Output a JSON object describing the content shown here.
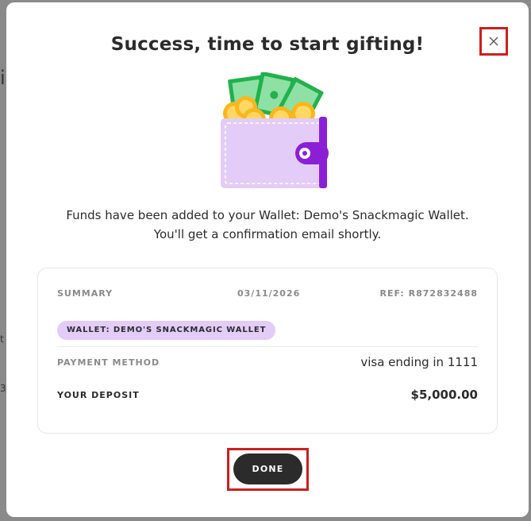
{
  "modal": {
    "title": "Success, time to start gifting!",
    "message_line1": "Funds have been added to your Wallet: Demo's Snackmagic Wallet.",
    "message_line2": "You'll get a confirmation email shortly.",
    "close_icon": "close-icon",
    "done_label": "DONE"
  },
  "summary": {
    "label": "SUMMARY",
    "date": "03/11/2026",
    "ref": "REF: R872832488",
    "wallet_tag": "WALLET: DEMO'S SNACKMAGIC WALLET",
    "payment_method_label": "PAYMENT METHOD",
    "payment_method_value": "visa ending in 1111",
    "deposit_label": "YOUR DEPOSIT",
    "deposit_value": "$5,000.00"
  },
  "colors": {
    "highlight": "#cc1f1f",
    "button": "#2b2b2b",
    "tag_bg": "#e3ccf7",
    "wallet_purple": "#8b1fd6",
    "cash_green": "#22b14c",
    "coin_gold": "#f7b71e"
  }
}
